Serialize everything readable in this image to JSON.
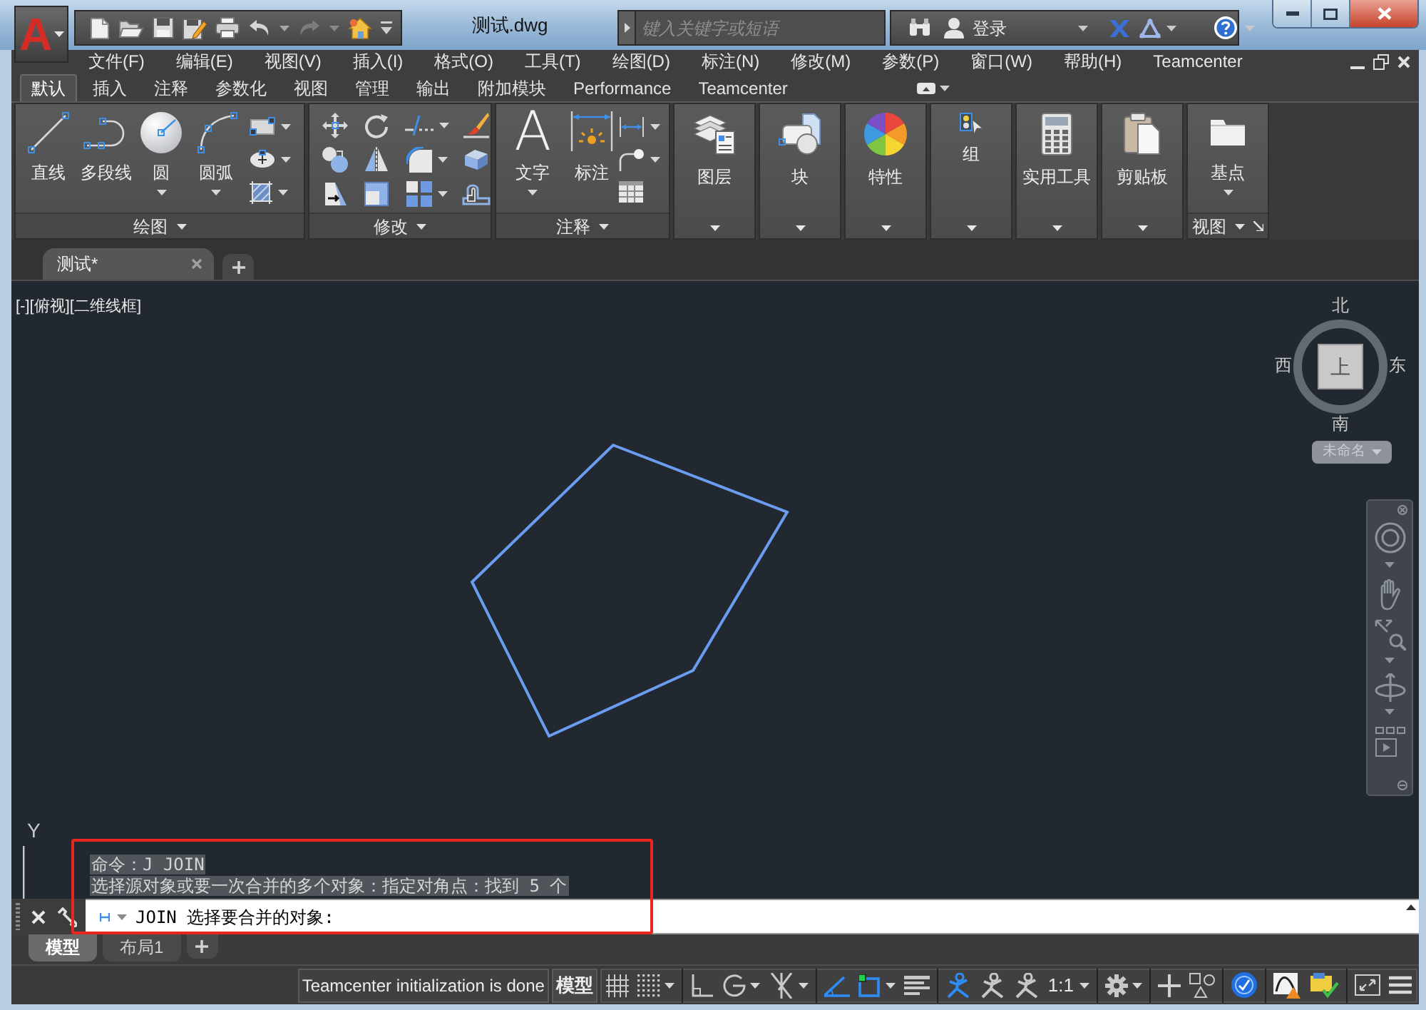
{
  "window": {
    "title": "测试.dwg"
  },
  "app_menu": {
    "logo": "A"
  },
  "search": {
    "placeholder": "键入关键字或短语"
  },
  "account": {
    "label": "登录"
  },
  "menu_bar": [
    "文件(F)",
    "编辑(E)",
    "视图(V)",
    "插入(I)",
    "格式(O)",
    "工具(T)",
    "绘图(D)",
    "标注(N)",
    "修改(M)",
    "参数(P)",
    "窗口(W)",
    "帮助(H)",
    "Teamcenter"
  ],
  "ribbon_tabs": [
    {
      "label": "默认",
      "selected": true
    },
    {
      "label": "插入",
      "selected": false
    },
    {
      "label": "注释",
      "selected": false
    },
    {
      "label": "参数化",
      "selected": false
    },
    {
      "label": "视图",
      "selected": false
    },
    {
      "label": "管理",
      "selected": false
    },
    {
      "label": "输出",
      "selected": false
    },
    {
      "label": "附加模块",
      "selected": false
    },
    {
      "label": "Performance",
      "selected": false
    },
    {
      "label": "Teamcenter",
      "selected": false
    }
  ],
  "draw_panel": {
    "title": "绘图",
    "tools": [
      {
        "label": "直线",
        "dropdown": false
      },
      {
        "label": "多段线",
        "dropdown": false
      },
      {
        "label": "圆",
        "dropdown": true
      },
      {
        "label": "圆弧",
        "dropdown": true
      }
    ]
  },
  "modify_panel": {
    "title": "修改"
  },
  "annotation_panel": {
    "title": "注释",
    "tools": [
      {
        "label": "文字",
        "glyph": "A",
        "dropdown": true
      },
      {
        "label": "标注",
        "dropdown": false
      }
    ]
  },
  "collapsed_panels": [
    {
      "title": "图层"
    },
    {
      "title": "块"
    },
    {
      "title": "特性"
    },
    {
      "title": "组"
    },
    {
      "title": "实用工具"
    },
    {
      "title": "剪贴板"
    }
  ],
  "view_panel": {
    "title": "视图",
    "tool": {
      "label": "基点",
      "dropdown": true
    }
  },
  "document_tabs": [
    {
      "label": "测试*",
      "selected": true
    }
  ],
  "viewport": {
    "label": "[-][俯视][二维线框]",
    "viewcube": {
      "north": "北",
      "east": "东",
      "south": "南",
      "west": "西",
      "face": "上",
      "ucs": "未命名"
    },
    "ucs_axis": "Y"
  },
  "command_history": [
    "命令：J JOIN",
    "选择源对象或要一次合并的多个对象：指定对角点：找到 5 个"
  ],
  "command_line": {
    "prompt": "JOIN 选择要合并的对象:"
  },
  "layout_tabs": [
    {
      "label": "模型",
      "selected": true
    },
    {
      "label": "布局1",
      "selected": false
    }
  ],
  "status_bar": {
    "message": "Teamcenter initialization is done",
    "space": "模型",
    "toggles": [
      {
        "on": false,
        "dropdown": false
      },
      {
        "on": false,
        "dropdown": true
      },
      {
        "on": false,
        "dropdown": false
      },
      {
        "on": false,
        "dropdown": true
      },
      {
        "on": false,
        "dropdown": true
      },
      {
        "on": true,
        "dropdown": false
      },
      {
        "on": true,
        "dropdown": true
      },
      {
        "on": false,
        "dropdown": false
      },
      {
        "on": true,
        "dropdown": false
      },
      {
        "on": false,
        "dropdown": false
      },
      {
        "on": false,
        "dropdown": false
      }
    ],
    "scale": "1:1",
    "isolate": {
      "on": true
    }
  }
}
